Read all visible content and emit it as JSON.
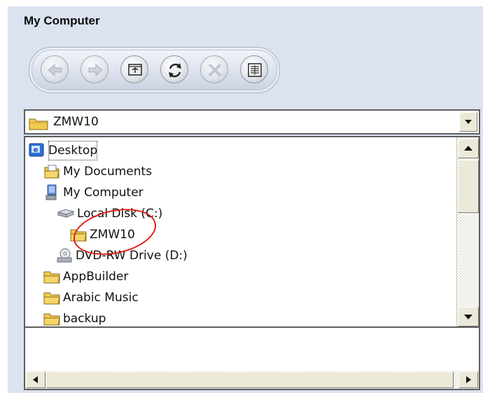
{
  "header": {
    "title": "My Computer"
  },
  "toolbar": {
    "buttons": [
      {
        "name": "back-button",
        "icon": "back-arrow-icon",
        "enabled": false
      },
      {
        "name": "forward-button",
        "icon": "forward-arrow-icon",
        "enabled": false
      },
      {
        "name": "up-folder-button",
        "icon": "up-folder-icon",
        "enabled": true
      },
      {
        "name": "refresh-button",
        "icon": "refresh-icon",
        "enabled": true
      },
      {
        "name": "stop-button",
        "icon": "stop-icon",
        "enabled": false
      },
      {
        "name": "view-button",
        "icon": "details-view-icon",
        "enabled": true
      }
    ]
  },
  "address": {
    "value": "ZMW10",
    "icon": "folder-icon"
  },
  "tree": {
    "items": [
      {
        "label": "Desktop",
        "icon": "desktop-icon",
        "focused": true
      },
      {
        "label": "My Documents",
        "icon": "my-documents-icon"
      },
      {
        "label": "My Computer",
        "icon": "my-computer-icon"
      },
      {
        "label": "Local Disk (C:)",
        "icon": "hard-drive-icon"
      },
      {
        "label": "ZMW10",
        "icon": "folder-icon"
      },
      {
        "label": "DVD-RW Drive (D:)",
        "icon": "dvd-drive-icon"
      },
      {
        "label": "AppBuilder",
        "icon": "folder-icon"
      },
      {
        "label": "Arabic Music",
        "icon": "folder-icon"
      },
      {
        "label": "backup",
        "icon": "folder-icon"
      }
    ]
  },
  "colors": {
    "panel_bg": "#dbe3f1",
    "annotation": "#e0201b",
    "folder": "#f1c94f"
  }
}
